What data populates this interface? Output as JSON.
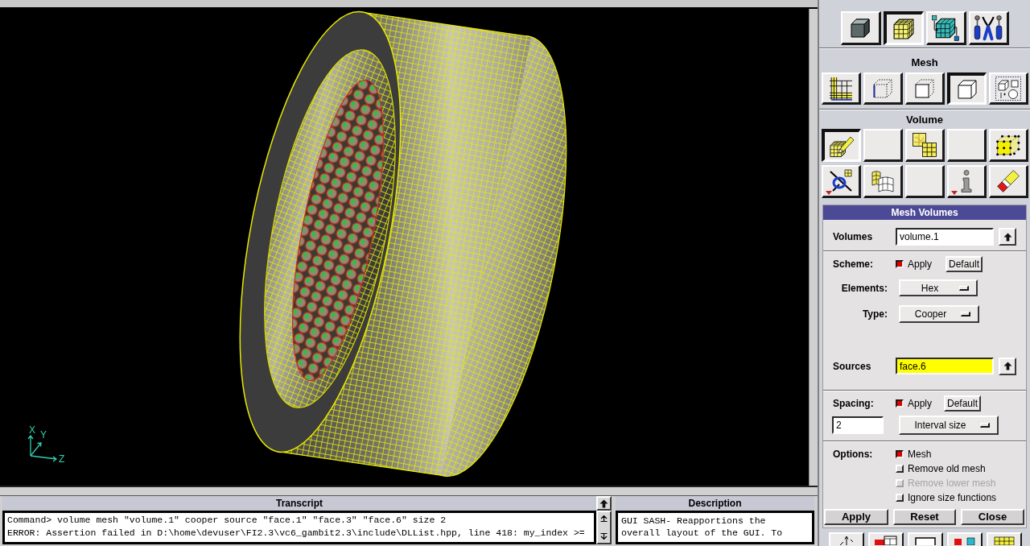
{
  "graphics": {
    "axes": [
      {
        "label": "X"
      },
      {
        "label": "Y"
      },
      {
        "label": "Z"
      }
    ]
  },
  "operation": {
    "buttons": [
      {
        "kind": "geometry",
        "selected": false
      },
      {
        "kind": "mesh",
        "selected": true
      },
      {
        "kind": "zones",
        "selected": false
      },
      {
        "kind": "tools",
        "selected": false
      }
    ]
  },
  "mesh": {
    "title": "Mesh",
    "buttons": [
      {
        "kind": "boundary",
        "selected": false
      },
      {
        "kind": "edge",
        "selected": false
      },
      {
        "kind": "face",
        "selected": false
      },
      {
        "kind": "volume",
        "selected": true
      },
      {
        "kind": "group",
        "selected": false
      }
    ]
  },
  "volume": {
    "title": "Volume",
    "buttons": [
      {
        "kind": "create",
        "selected": true,
        "menu": false
      },
      {
        "kind": "blank",
        "selected": false,
        "menu": false
      },
      {
        "kind": "smooth",
        "selected": false,
        "menu": false
      },
      {
        "kind": "blank",
        "selected": false,
        "menu": false
      },
      {
        "kind": "nodes",
        "selected": false,
        "menu": false
      },
      {
        "kind": "link",
        "selected": false,
        "menu": true
      },
      {
        "kind": "sheets",
        "selected": false,
        "menu": false
      },
      {
        "kind": "blank",
        "selected": false,
        "menu": false
      },
      {
        "kind": "info",
        "selected": false,
        "menu": true
      },
      {
        "kind": "erase",
        "selected": false,
        "menu": false
      }
    ]
  },
  "form": {
    "title": "Mesh Volumes",
    "volumes": {
      "label": "Volumes",
      "value": "volume.1",
      "highlighted": false
    },
    "scheme": {
      "label": "Scheme:",
      "apply": {
        "label": "Apply",
        "checked": true
      },
      "default_button": "Default"
    },
    "elements": {
      "label": "Elements:",
      "value": "Hex"
    },
    "type": {
      "label": "Type:",
      "value": "Cooper"
    },
    "sources": {
      "label": "Sources",
      "value": "face.6",
      "highlighted": true
    },
    "spacing": {
      "label": "Spacing:",
      "apply": {
        "label": "Apply",
        "checked": true
      },
      "default_button": "Default",
      "value": "2",
      "mode": "Interval size"
    },
    "options": {
      "label": "Options:",
      "items": [
        {
          "label": "Mesh",
          "checked": true,
          "disabled": false
        },
        {
          "label": "Remove old mesh",
          "checked": false,
          "disabled": false
        },
        {
          "label": "Remove lower mesh",
          "checked": false,
          "disabled": true
        },
        {
          "label": "Ignore size functions",
          "checked": false,
          "disabled": false
        }
      ]
    },
    "buttons": [
      "Apply",
      "Reset",
      "Close"
    ]
  },
  "toolbar": {
    "buttons": [
      {
        "kind": "orient"
      },
      {
        "kind": "display"
      },
      {
        "kind": "frame"
      },
      {
        "kind": "shapes"
      },
      {
        "kind": "render"
      }
    ]
  },
  "transcript": {
    "title": "Transcript",
    "lines": [
      "Command> volume mesh \"volume.1\" cooper source \"face.1\" \"face.3\" \"face.6\" size 2",
      "ERROR: Assertion failed in D:\\home\\devuser\\FI2.3\\vc6_gambit2.3\\include\\DLList.hpp, line 418: my_index >="
    ]
  },
  "description": {
    "title": "Description",
    "text": "GUI SASH- Reapportions the overall layout of the GUI. To"
  }
}
